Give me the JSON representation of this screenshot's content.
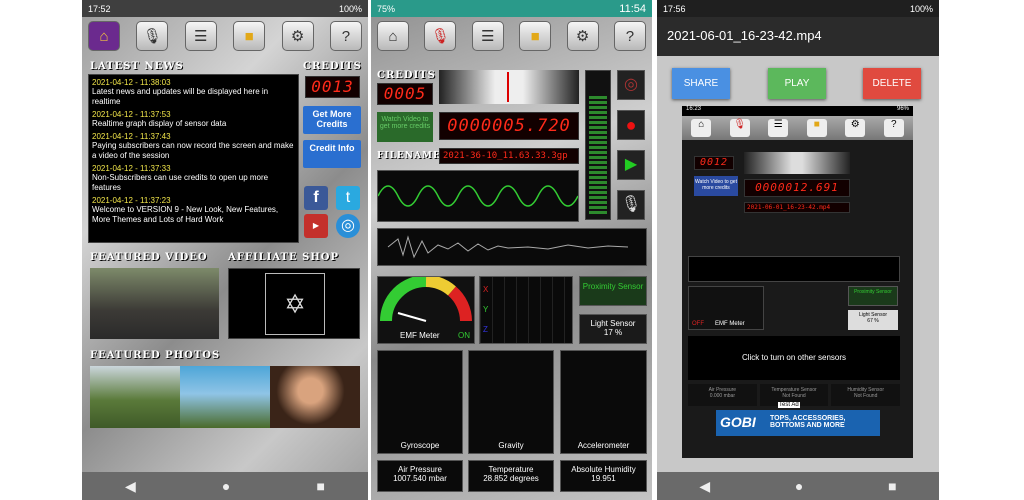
{
  "p1": {
    "status": {
      "time": "17:52",
      "battery": "100%"
    },
    "news_title": "LATEST NEWS",
    "credits_title": "CREDITS",
    "credits_value": "0013",
    "news": [
      {
        "date": "2021-04-12 - 11:38:03",
        "text": "Latest news and updates will be displayed here in realtime"
      },
      {
        "date": "2021-04-12 - 11:37:53",
        "text": "Realtime graph display of sensor data"
      },
      {
        "date": "2021-04-12 - 11:37:43",
        "text": "Paying subscribers can now record the screen and make a video of the session"
      },
      {
        "date": "2021-04-12 - 11:37:33",
        "text": "Non-Subscribers can use credits to open up more features"
      },
      {
        "date": "2021-04-12 - 11:37:23",
        "text": "Welcome to VERSION 9 - New Look, New Features, More Themes and Lots of Hard Work"
      }
    ],
    "get_credits": "Get More Credits",
    "credit_info": "Credit Info",
    "featured_video": "FEATURED VIDEO",
    "affiliate_shop": "AFFILIATE SHOP",
    "featured_photos": "FEATURED PHOTOS"
  },
  "p2": {
    "status": {
      "time": "11:54",
      "battery": "75%"
    },
    "credits_title": "CREDITS",
    "credits_value": "0005",
    "watch_video": "Watch Video to get more credits",
    "reading": "0000005.720",
    "filename_label": "FILENAME:",
    "filename": "2021-36-10_11.63.33.3gp",
    "emf_label": "EMF Meter",
    "on_label": "ON",
    "proximity": "Proximity Sensor",
    "light_sensor": "Light Sensor",
    "light_value": "17 %",
    "graphs": [
      "Gyroscope",
      "Gravity",
      "Accelerometer"
    ],
    "readouts": [
      {
        "label": "Air Pressure",
        "value": "1007.540 mbar"
      },
      {
        "label": "Temperature",
        "value": "28.852 degrees"
      },
      {
        "label": "Absolute Humidity",
        "value": "19.951"
      }
    ]
  },
  "p3": {
    "status": {
      "time": "17:56",
      "battery": "100%"
    },
    "title": "2021-06-01_16-23-42.mp4",
    "share": "SHARE",
    "play": "PLAY",
    "delete": "DELETE",
    "inner_time": "16:23",
    "inner_battery": "96%",
    "inner_credits": "0012",
    "inner_reading": "0000012.691",
    "inner_filename": "2021-06-01_16-23-42.mp4",
    "inner_watch": "Watch Video to get more credits",
    "inner_light": "Light Sensor",
    "inner_light_value": "67 %",
    "inner_prox": "Proximity Sensor",
    "inner_emf": "EMF Meter",
    "inner_off": "OFF",
    "inner_other": "Click to turn on other sensors",
    "inner_cells": [
      "Air Pressure",
      "Temperature Sensor",
      "Humidity Sensor"
    ],
    "inner_cell_values": [
      "0.000 mbar",
      "Not Found",
      "Not Found"
    ],
    "ad_label": "Test Ad",
    "ad_brand": "GOBI",
    "ad_text": "TOPS, ACCESSORIES, BOTTOMS AND MORE"
  }
}
